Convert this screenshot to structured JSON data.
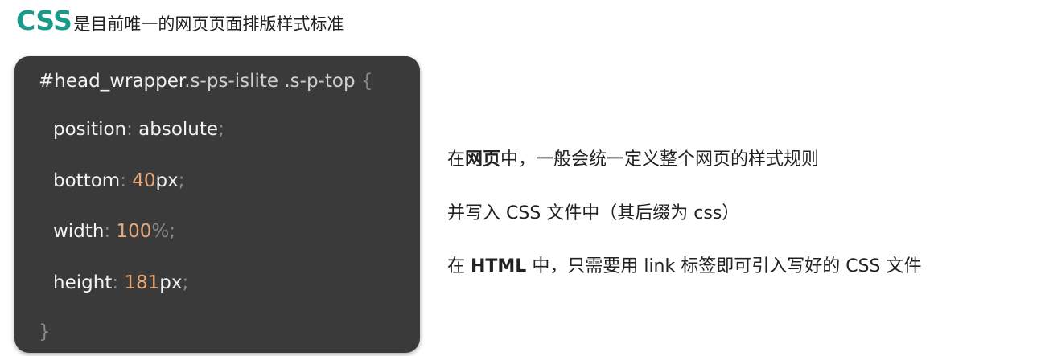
{
  "heading": {
    "accent": "CSS",
    "rest": "是目前唯一的网页页面排版样式标准"
  },
  "code": {
    "selector_id": "#head_wrapper",
    "selector_class1": ".s-ps-islite",
    "selector_class2": " .s-p-top",
    "open_brace": " {",
    "lines": [
      {
        "prop": "position",
        "value_prefix": "absolute",
        "number": "",
        "unit": "",
        "end": ";"
      },
      {
        "prop": "bottom",
        "value_prefix": "",
        "number": "40",
        "unit": "px",
        "end": ";"
      },
      {
        "prop": "width",
        "value_prefix": "",
        "number": "100",
        "unit": "%",
        "end": ";"
      },
      {
        "prop": "height",
        "value_prefix": "",
        "number": "181",
        "unit": "px",
        "end": ";"
      }
    ],
    "close_brace": "}"
  },
  "notes": {
    "line1": {
      "pre": "在",
      "bold": "网页",
      "post": "中，一般会统一定义整个网页的样式规则"
    },
    "line2": {
      "text": "并写入 CSS 文件中（其后缀为 css）"
    },
    "line3": {
      "pre": "在 ",
      "bold": "HTML",
      "post": " 中，只需要用 link 标签即可引入写好的 CSS 文件"
    }
  },
  "colors": {
    "accent": "#1a9a8a",
    "code_background": "#3a3a3a",
    "number": "#e8a878"
  }
}
